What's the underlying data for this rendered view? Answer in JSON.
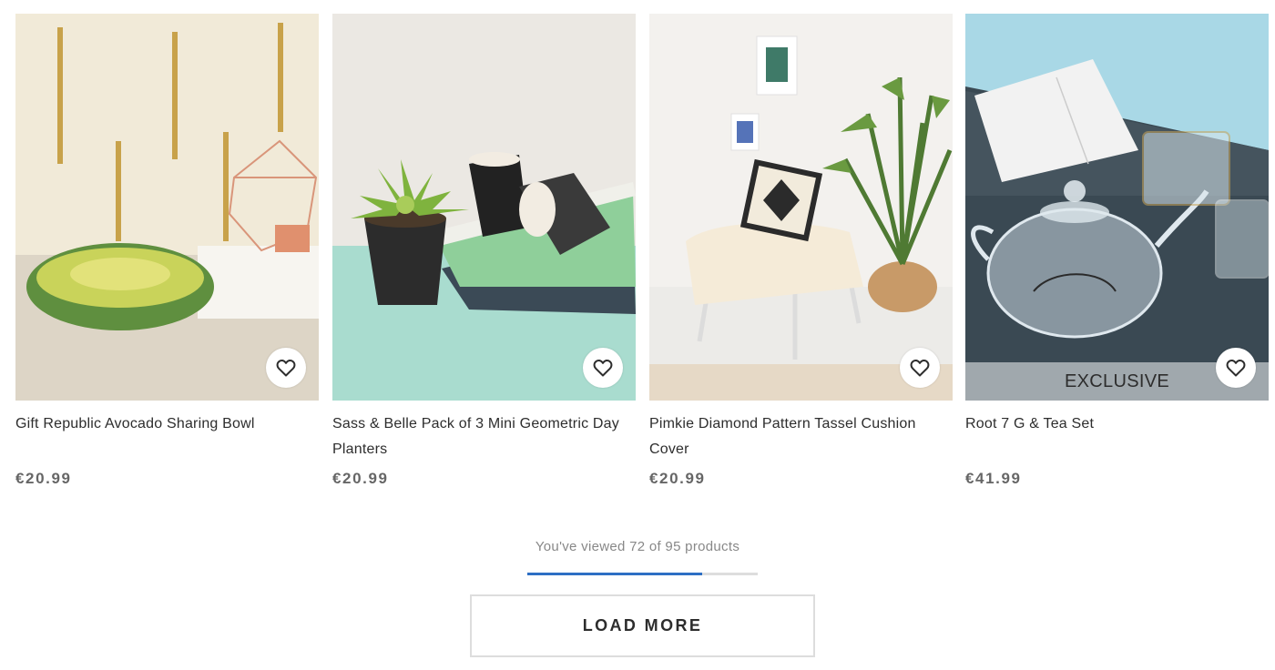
{
  "products": [
    {
      "title": "Gift Republic Avocado Sharing Bowl",
      "price": "€20.99",
      "badge": ""
    },
    {
      "title": "Sass & Belle Pack of 3 Mini Geometric Day Planters",
      "price": "€20.99",
      "badge": ""
    },
    {
      "title": "Pimkie Diamond Pattern Tassel Cushion Cover",
      "price": "€20.99",
      "badge": ""
    },
    {
      "title": "Root 7 G & Tea Set",
      "price": "€41.99",
      "badge": "EXCLUSIVE"
    }
  ],
  "wishlist_icon": "heart-outline-icon",
  "progress": {
    "text": "You've viewed 72 of 95 products",
    "viewed": 72,
    "total": 95
  },
  "load_more_label": "LOAD MORE",
  "colors": {
    "progress_fill": "#2d6fc4",
    "progress_track": "#dddddd",
    "price": "#666666"
  }
}
